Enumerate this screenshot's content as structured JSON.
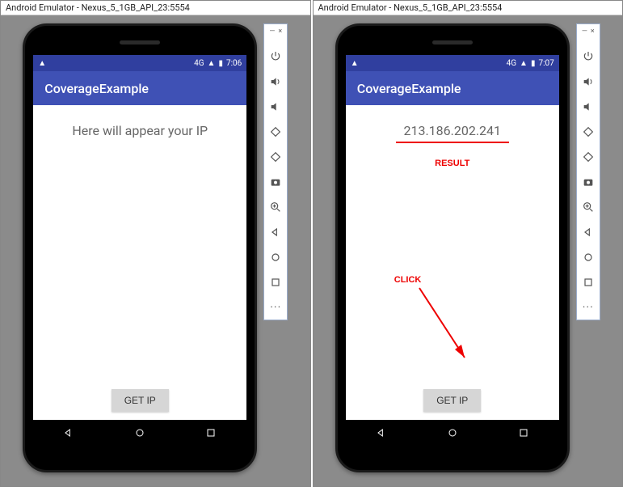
{
  "windowTitle": "Android Emulator - Nexus_5_1GB_API_23:5554",
  "left": {
    "statusTime": "7:06",
    "signalGlyph": "▲",
    "appTitle": "CoverageExample",
    "ipText": "Here will appear your IP",
    "getIpLabel": "GET IP"
  },
  "right": {
    "statusTime": "7:07",
    "signalGlyph": "▲",
    "appTitle": "CoverageExample",
    "ipText": "213.186.202.241",
    "getIpLabel": "GET IP",
    "annotationResult": "RESULT",
    "annotationClick": "CLICK"
  },
  "toolbar": {
    "minimize": "—",
    "close": "×"
  },
  "signalLabel": "4G",
  "batteryGlyph": "▮",
  "warningGlyph": "▲"
}
